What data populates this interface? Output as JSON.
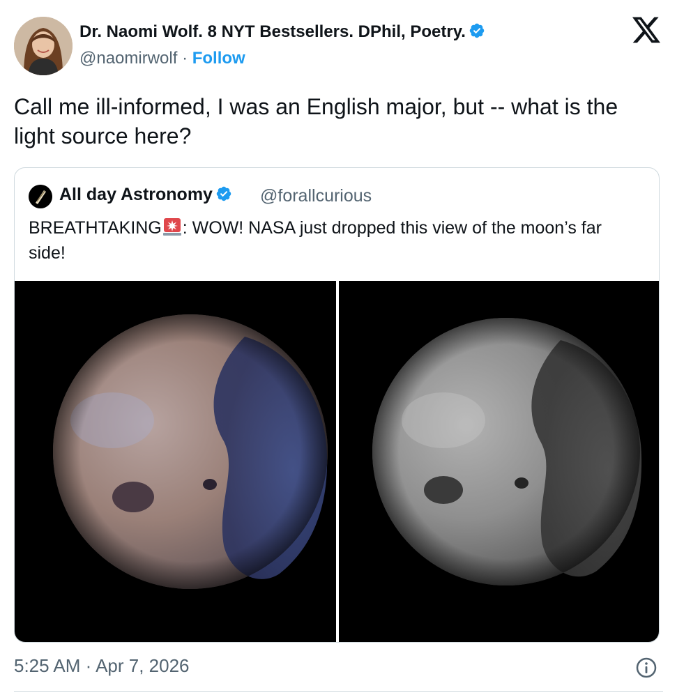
{
  "tweet": {
    "author": {
      "name": "Dr. Naomi Wolf. 8 NYT Bestsellers. DPhil, Poetry.",
      "handle": "@naomirwolf",
      "separator": " · ",
      "follow_label": "Follow",
      "verified_icon": "verified-badge-icon"
    },
    "platform_icon": "x-logo-icon",
    "text": "Call me ill-informed, I was an English major, but -- what is the light source here?",
    "quoted": {
      "name": "All day Astronomy",
      "handle": "@forallcurious",
      "text_prefix": "BREATHTAKING",
      "text_emoji": "siren-icon",
      "text_suffix": ": WOW! NASA just dropped this view of the moon’s far side!",
      "images": [
        "moon-color-image",
        "moon-grayscale-image"
      ]
    },
    "timestamp": "5:25 AM · Apr 7, 2026",
    "info_icon": "info-icon"
  },
  "colors": {
    "accent": "#1d9bf0",
    "secondary_text": "#536471",
    "border": "#cfd9de"
  }
}
